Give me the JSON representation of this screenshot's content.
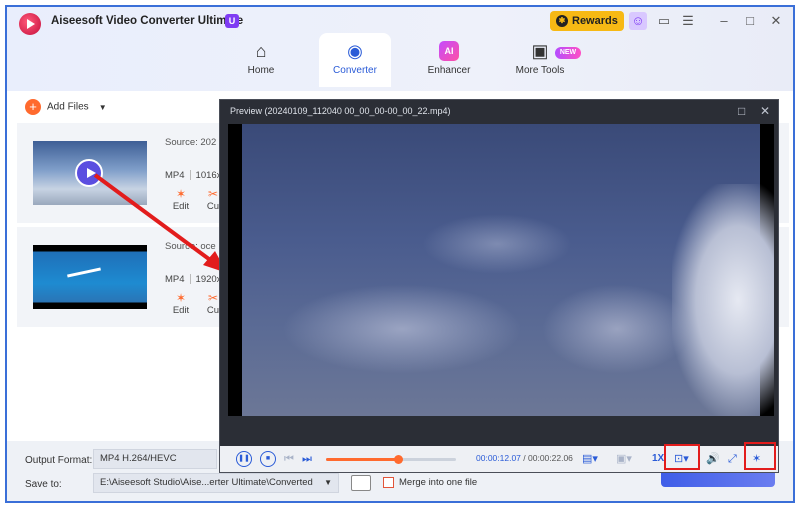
{
  "app": {
    "title": "Aiseesoft Video Converter Ultimate",
    "badge": "U",
    "rewards_label": "Rewards"
  },
  "tabs": [
    {
      "label": "Home",
      "icon": "home-icon"
    },
    {
      "label": "Converter",
      "icon": "converter-icon"
    },
    {
      "label": "Enhancer",
      "icon": "ai-icon"
    },
    {
      "label": "More Tools",
      "icon": "toolbox-icon"
    }
  ],
  "new_badge": "NEW",
  "toolbar": {
    "add_files": "Add Files"
  },
  "files": [
    {
      "source": "Source: 202",
      "format": "MP4",
      "resolution": "1016x",
      "edit": "Edit",
      "cut": "Cu"
    },
    {
      "source": "Source: oce",
      "format": "MP4",
      "resolution": "1920x",
      "edit": "Edit",
      "cut": "Cu"
    }
  ],
  "bottom": {
    "output_label": "Output Format:",
    "output_value": "MP4 H.264/HEVC",
    "save_label": "Save to:",
    "save_value": "E:\\Aiseesoft Studio\\Aise...erter Ultimate\\Converted",
    "merge_label": "Merge into one file"
  },
  "preview": {
    "title": "Preview (20240109_112040 00_00_00-00_00_22.mp4)",
    "current_time": "00:00:12.07",
    "total_time": "/ 00:00:22.06",
    "speed": "1X",
    "progress": 0.55
  },
  "colors": {
    "accent": "#2a5bd7",
    "orange": "#ff6a2e",
    "highlight": "#e21c1c",
    "rewards": "#f7b914"
  }
}
